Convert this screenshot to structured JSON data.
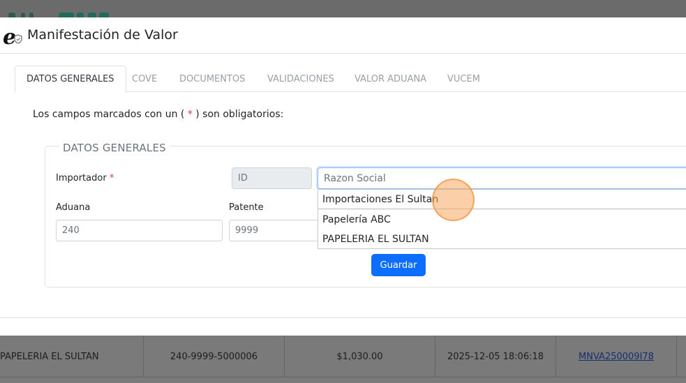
{
  "modal": {
    "title": "Manifestación de Valor",
    "brand_icon": "e-shield-logo-icon"
  },
  "tabs": [
    {
      "label": "DATOS GENERALES",
      "active": true
    },
    {
      "label": "COVE",
      "active": false
    },
    {
      "label": "DOCUMENTOS",
      "active": false
    },
    {
      "label": "VALIDACIONES",
      "active": false
    },
    {
      "label": "VALOR ADUANA",
      "active": false
    },
    {
      "label": "VUCEM",
      "active": false
    }
  ],
  "required_note": {
    "prefix": "Los campos marcados con un (",
    "star": "*",
    "suffix": ") son obligatorios:"
  },
  "section": {
    "legend": "DATOS GENERALES",
    "importador_label": "Importador",
    "required_star": "*",
    "id_placeholder": "ID",
    "razon_social_placeholder": "Razon Social",
    "aduana_label": "Aduana",
    "aduana_value": "240",
    "patente_label": "Patente",
    "patente_value": "9999",
    "save_label": "Guardar"
  },
  "autocomplete": {
    "options": [
      "Importaciones El Sultan",
      "Papelería ABC",
      "PAPELERIA EL SULTAN"
    ]
  },
  "background_table": {
    "row": {
      "razon_social": "PAPELERIA EL SULTAN",
      "pedimento": "240-9999-5000006",
      "monto": "$1,030.00",
      "fecha": "2025-12-05 18:06:18",
      "folio": "MNVA250009I78"
    }
  },
  "colors": {
    "primary": "#0d6efd",
    "required": "#dc3545",
    "click_indicator": "#f7a760"
  }
}
